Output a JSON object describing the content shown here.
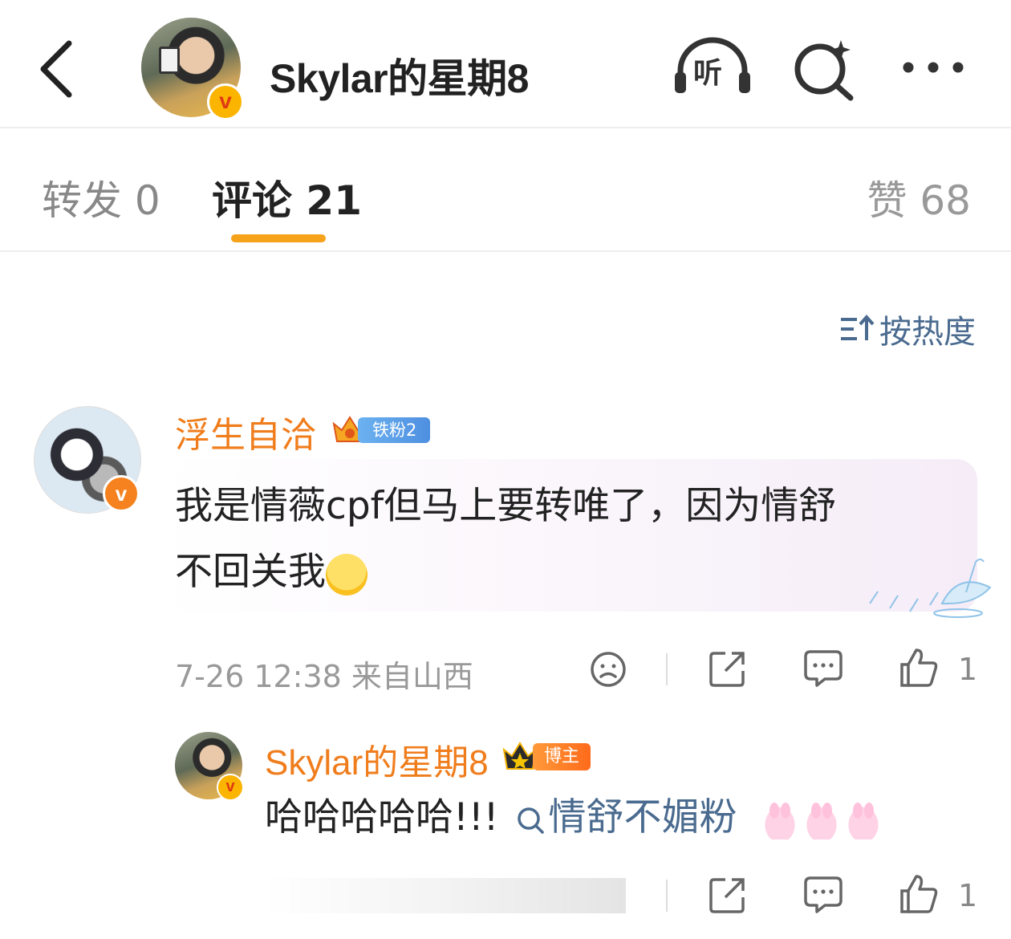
{
  "header": {
    "title": "Skylar的星期8",
    "listen_label": "听"
  },
  "tabs": {
    "repost": "转发 0",
    "comments": "评论 21",
    "likes": "赞 68"
  },
  "sort": {
    "label": "按热度"
  },
  "comments": [
    {
      "username": "浮生自洽",
      "fan_badge": "铁粉2",
      "text_line1": "我是情薇cpf但马上要转唯了，因为情舒",
      "text_line2": "不回关我",
      "time_location": "7-26 12:38  来自山西",
      "like_count": "1",
      "reply": {
        "username": "Skylar的星期8",
        "badge": "博主",
        "text": "哈哈哈哈哈!!!",
        "topic": "情舒不媚粉",
        "like_count": "1"
      }
    }
  ],
  "colors": {
    "accent_orange": "#f7a21b",
    "username_orange": "#f07d1c",
    "link_blue": "#4a6b8f"
  }
}
